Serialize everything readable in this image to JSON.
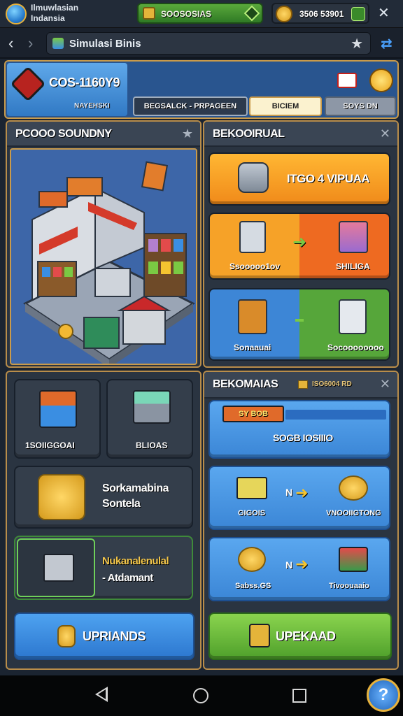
{
  "topbar": {
    "app_title_line1": "Ilmuwlasian",
    "app_title_line2": "Indansia",
    "resource1_value": "SOOSOSIAS",
    "resource2_value": "3506 53901"
  },
  "navbar": {
    "page_title": "Simulasi Binis"
  },
  "header": {
    "store_id": "COS-1160Y9",
    "store_sub": "NAYEHSKI",
    "tabs": [
      "BEGSALCK - PRPAGEEN",
      "BICIEM",
      "SOYS DN"
    ]
  },
  "left_top": {
    "title": "PCOOO SOUNDNY"
  },
  "right_top": {
    "title": "BEKOOIRUAL",
    "items": [
      {
        "label": "ITGO 4 VIPUAA"
      },
      {
        "left_label": "Ssooooo1ov",
        "right_label": "SHILIGA"
      },
      {
        "left_label": "Sonaauai",
        "right_label": "Socoooooooo"
      }
    ]
  },
  "left_bottom": {
    "tiles": [
      "1SOIIGGOAI",
      "BLIOAS"
    ],
    "coins_line1": "Sorkamabina",
    "coins_line2": "Sontela",
    "box_line1": "Nukanalenulal",
    "box_line2": "- Atdamant",
    "button": "UPRIANDS"
  },
  "right_bottom": {
    "title": "BEKOMAIAS",
    "subtitle": "ISO6004 RD",
    "tag": "SY BOB",
    "banner_text": "SOGB IOSIIIO",
    "rows": [
      {
        "left": "GIGOIS",
        "mid": "N",
        "right": "VNOOIIGTONG"
      },
      {
        "left": "Sabss.GS",
        "mid": "N",
        "right": "Tivoouaaio"
      }
    ],
    "button": "UPEKAAD"
  },
  "colors": {
    "accent_gold": "#c99a4a",
    "orange": "#f4a321",
    "blue": "#3a8ee2",
    "green": "#7ac943"
  }
}
